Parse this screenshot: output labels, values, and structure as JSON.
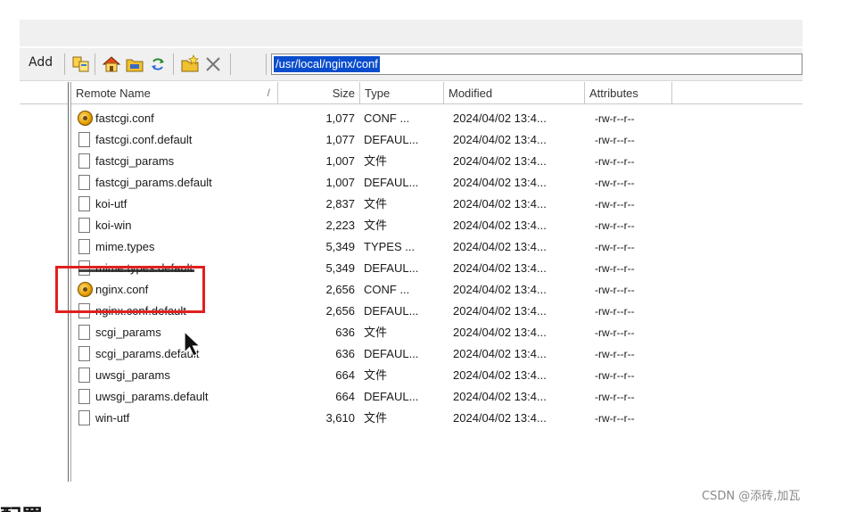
{
  "toolbar": {
    "add_label": "Add",
    "path": "/usr/local/nginx/conf",
    "icons": [
      "copy-icon",
      "home-icon",
      "folder-icon",
      "refresh-icon",
      "new-folder-icon",
      "delete-icon"
    ]
  },
  "columns": {
    "name": "Remote Name",
    "sort": "/",
    "size": "Size",
    "type": "Type",
    "modified": "Modified",
    "attributes": "Attributes"
  },
  "files": [
    {
      "name": "fastcgi.conf",
      "size": "1,077",
      "type": "CONF ...",
      "modified": "2024/04/02 13:4...",
      "attributes": "-rw-r--r--",
      "icon": "gear"
    },
    {
      "name": "fastcgi.conf.default",
      "size": "1,077",
      "type": "DEFAUL...",
      "modified": "2024/04/02 13:4...",
      "attributes": "-rw-r--r--",
      "icon": "file"
    },
    {
      "name": "fastcgi_params",
      "size": "1,007",
      "type": "文件",
      "modified": "2024/04/02 13:4...",
      "attributes": "-rw-r--r--",
      "icon": "file"
    },
    {
      "name": "fastcgi_params.default",
      "size": "1,007",
      "type": "DEFAUL...",
      "modified": "2024/04/02 13:4...",
      "attributes": "-rw-r--r--",
      "icon": "file"
    },
    {
      "name": "koi-utf",
      "size": "2,837",
      "type": "文件",
      "modified": "2024/04/02 13:4...",
      "attributes": "-rw-r--r--",
      "icon": "file"
    },
    {
      "name": "koi-win",
      "size": "2,223",
      "type": "文件",
      "modified": "2024/04/02 13:4...",
      "attributes": "-rw-r--r--",
      "icon": "file"
    },
    {
      "name": "mime.types",
      "size": "5,349",
      "type": "TYPES ...",
      "modified": "2024/04/02 13:4...",
      "attributes": "-rw-r--r--",
      "icon": "file"
    },
    {
      "name": "mime.types.default",
      "size": "5,349",
      "type": "DEFAUL...",
      "modified": "2024/04/02 13:4...",
      "attributes": "-rw-r--r--",
      "icon": "file"
    },
    {
      "name": "nginx.conf",
      "size": "2,656",
      "type": "CONF ...",
      "modified": "2024/04/02 13:4...",
      "attributes": "-rw-r--r--",
      "icon": "gear"
    },
    {
      "name": "nginx.conf.default",
      "size": "2,656",
      "type": "DEFAUL...",
      "modified": "2024/04/02 13:4...",
      "attributes": "-rw-r--r--",
      "icon": "file"
    },
    {
      "name": "scgi_params",
      "size": "636",
      "type": "文件",
      "modified": "2024/04/02 13:4...",
      "attributes": "-rw-r--r--",
      "icon": "file"
    },
    {
      "name": "scgi_params.default",
      "size": "636",
      "type": "DEFAUL...",
      "modified": "2024/04/02 13:4...",
      "attributes": "-rw-r--r--",
      "icon": "file"
    },
    {
      "name": "uwsgi_params",
      "size": "664",
      "type": "文件",
      "modified": "2024/04/02 13:4...",
      "attributes": "-rw-r--r--",
      "icon": "file"
    },
    {
      "name": "uwsgi_params.default",
      "size": "664",
      "type": "DEFAUL...",
      "modified": "2024/04/02 13:4...",
      "attributes": "-rw-r--r--",
      "icon": "file"
    },
    {
      "name": "win-utf",
      "size": "3,610",
      "type": "文件",
      "modified": "2024/04/02 13:4...",
      "attributes": "-rw-r--r--",
      "icon": "file"
    }
  ],
  "watermark": "CSDN @添砖,加瓦",
  "clipped_heading": "配置",
  "colors": {
    "highlight": "#e02020",
    "path_selection": "#0a4dcc",
    "toolbar_bg": "#f0f0f0"
  }
}
